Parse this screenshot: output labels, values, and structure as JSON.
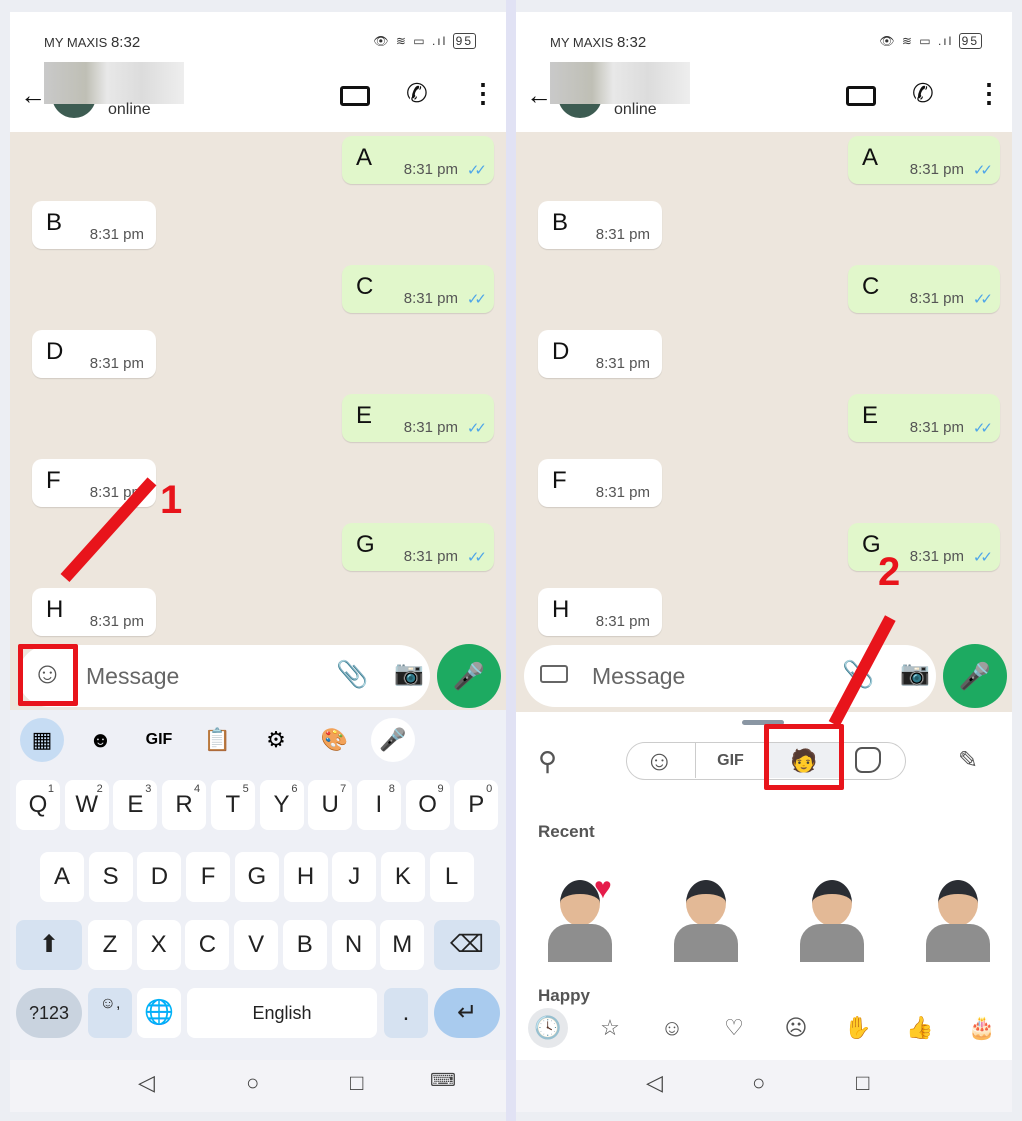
{
  "status": {
    "carrier": "MY MAXIS",
    "time": "8:32",
    "icons": "eye wifi VoWiFi signal",
    "battery": "95"
  },
  "header": {
    "presence": "online",
    "contact_name_blurred": true
  },
  "messages": [
    {
      "text": "A",
      "time": "8:31 pm",
      "dir": "out",
      "read": true
    },
    {
      "text": "B",
      "time": "8:31 pm",
      "dir": "in"
    },
    {
      "text": "C",
      "time": "8:31 pm",
      "dir": "out",
      "read": true
    },
    {
      "text": "D",
      "time": "8:31 pm",
      "dir": "in"
    },
    {
      "text": "E",
      "time": "8:31 pm",
      "dir": "out",
      "read": true
    },
    {
      "text": "F",
      "time": "8:31 pm",
      "dir": "in"
    },
    {
      "text": "G",
      "time": "8:31 pm",
      "dir": "out",
      "read": true
    },
    {
      "text": "H",
      "time": "8:31 pm",
      "dir": "in"
    }
  ],
  "input": {
    "placeholder": "Message"
  },
  "keyboard": {
    "toolbar": [
      "apps-icon",
      "sticker-icon",
      "GIF",
      "clipboard-icon",
      "settings-icon",
      "palette-icon",
      "mic-icon"
    ],
    "row1": [
      [
        "Q",
        "1"
      ],
      [
        "W",
        "2"
      ],
      [
        "E",
        "3"
      ],
      [
        "R",
        "4"
      ],
      [
        "T",
        "5"
      ],
      [
        "Y",
        "6"
      ],
      [
        "U",
        "7"
      ],
      [
        "I",
        "8"
      ],
      [
        "O",
        "9"
      ],
      [
        "P",
        "0"
      ]
    ],
    "row2": [
      "A",
      "S",
      "D",
      "F",
      "G",
      "H",
      "J",
      "K",
      "L"
    ],
    "row3": [
      "Z",
      "X",
      "C",
      "V",
      "B",
      "N",
      "M"
    ],
    "row4": {
      "symbols": "?123",
      "emoji": "☺,",
      "space": "English",
      "period": "."
    }
  },
  "sticker_panel": {
    "tabs": [
      "emoji",
      "GIF",
      "avatar",
      "sticker"
    ],
    "gif_label": "GIF",
    "recent_label": "Recent",
    "happy_label": "Happy",
    "categories": [
      "recent",
      "favorites",
      "happy",
      "love",
      "sad",
      "celebrate",
      "thumbs-up",
      "birthday"
    ]
  },
  "annotations": {
    "step1": "1",
    "step2": "2",
    "color": "#e8141b"
  },
  "colors": {
    "accent": "#1daa61",
    "outgoing": "#e1f7cb",
    "chat_bg": "#ede6dd",
    "read_ticks": "#4fa6e8"
  }
}
